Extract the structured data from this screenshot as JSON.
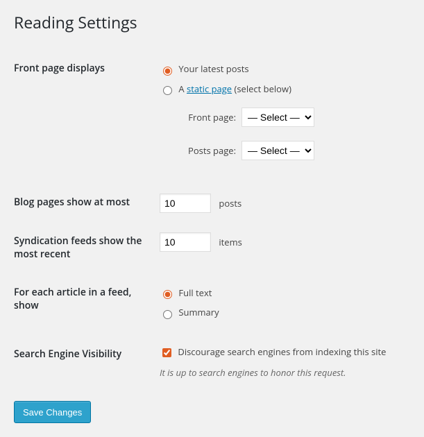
{
  "page_title": "Reading Settings",
  "front_page": {
    "row_label": "Front page displays",
    "option_latest": "Your latest posts",
    "option_static_prefix": "A ",
    "option_static_link": "static page",
    "option_static_suffix": " (select below)",
    "front_page_label": "Front page:",
    "posts_page_label": "Posts page:",
    "select_placeholder": "— Select —"
  },
  "blog_pages": {
    "row_label": "Blog pages show at most",
    "value": "10",
    "unit": "posts"
  },
  "syndication": {
    "row_label": "Syndication feeds show the most recent",
    "value": "10",
    "unit": "items"
  },
  "article_feed": {
    "row_label": "For each article in a feed, show",
    "option_full": "Full text",
    "option_summary": "Summary"
  },
  "search_engine": {
    "row_label": "Search Engine Visibility",
    "checkbox_label": "Discourage search engines from indexing this site",
    "description": "It is up to search engines to honor this request."
  },
  "submit": {
    "label": "Save Changes"
  }
}
